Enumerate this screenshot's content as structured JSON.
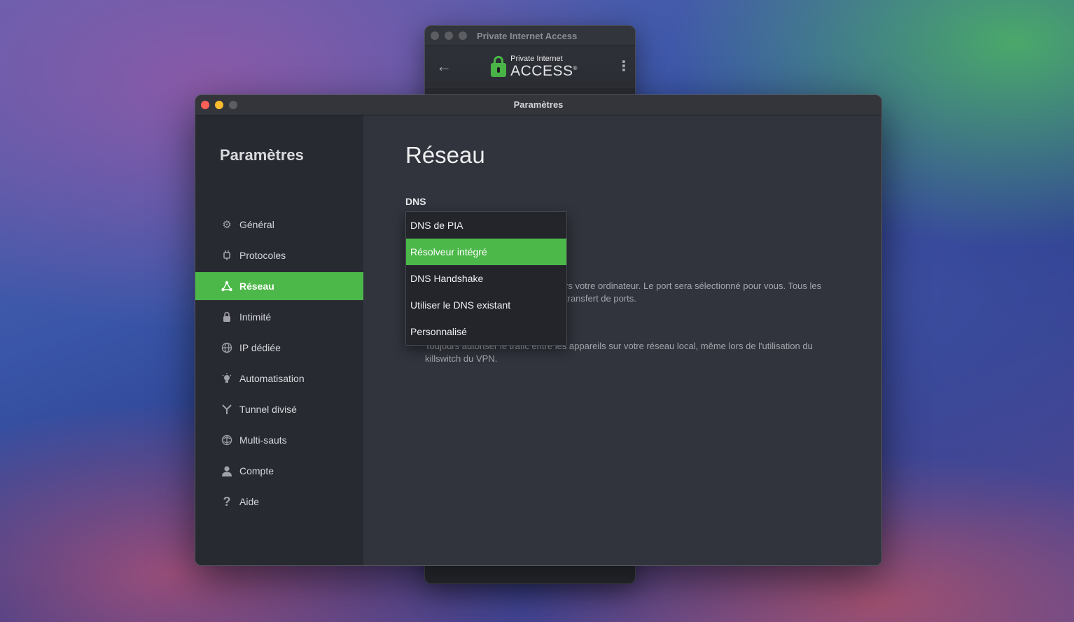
{
  "background_window": {
    "title": "Private Internet Access",
    "logo_small": "Private Internet",
    "logo_big": "ACCESS",
    "logo_mark": "®"
  },
  "settings_window": {
    "title": "Paramètres",
    "sidebar": {
      "title": "Paramètres",
      "items": [
        {
          "label": "Général",
          "icon": "gear-icon"
        },
        {
          "label": "Protocoles",
          "icon": "plug-icon"
        },
        {
          "label": "Réseau",
          "icon": "network-icon",
          "active": true
        },
        {
          "label": "Intimité",
          "icon": "lock-icon"
        },
        {
          "label": "IP dédiée",
          "icon": "globe-ip-icon"
        },
        {
          "label": "Automatisation",
          "icon": "bulb-icon"
        },
        {
          "label": "Tunnel divisé",
          "icon": "split-icon"
        },
        {
          "label": "Multi-sauts",
          "icon": "multihop-globe-icon"
        },
        {
          "label": "Compte",
          "icon": "user-icon"
        },
        {
          "label": "Aide",
          "icon": "question-icon"
        }
      ]
    },
    "main": {
      "page_title": "Réseau",
      "dns_label": "DNS",
      "dns_options": [
        "DNS de PIA",
        "Résolveur intégré",
        "DNS Handshake",
        "Utiliser le DNS existant",
        "Personnalisé"
      ],
      "dns_selected": "Résolveur intégré",
      "desc_port_forwarding": "rs votre ordinateur. Le port sera sélectionné pour vous. Tous les transfert de ports.",
      "desc_lan": "Toujours autoriser le trafic entre les appareils sur votre réseau local, même lors de l'utilisation du killswitch du VPN."
    }
  },
  "colors": {
    "accent": "#4cb849",
    "sidebar_bg": "#282a32",
    "main_bg": "#31343d"
  }
}
